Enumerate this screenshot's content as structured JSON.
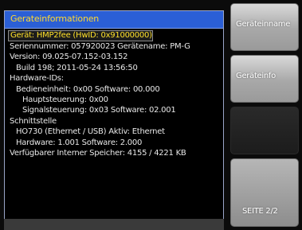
{
  "panel": {
    "title": "Gerateinformationen",
    "lines": [
      {
        "text": "Gerät: HMP2fee (HwID: 0x91000000)",
        "style": "hl"
      },
      {
        "text": "Seriennummer: 057920023 Gerätename: PM-G",
        "style": ""
      },
      {
        "text": "Version: 09.025-07.152-03.152",
        "style": ""
      },
      {
        "text": "Build 198; 2011-05-24 13:56:50",
        "style": "ind1"
      },
      {
        "text": "Hardware-IDs:",
        "style": ""
      },
      {
        "text": "Bedieneinheit: 0x00   Software: 00.000",
        "style": "ind1"
      },
      {
        "text": "Hauptsteuerung: 0x00",
        "style": "ind2"
      },
      {
        "text": "Signalsteuerung: 0x03   Software: 02.001",
        "style": "ind2"
      },
      {
        "text": "Schnittstelle",
        "style": ""
      },
      {
        "text": "HO730 (Ethernet / USB) Aktiv: Ethernet",
        "style": "ind1"
      },
      {
        "text": "Hardware: 1.001 Software: 2.000",
        "style": "ind1"
      },
      {
        "text": "Verfügbarer Interner Speicher: 4155 / 4221 KB",
        "style": ""
      }
    ]
  },
  "side_buttons": {
    "btn1": "Geräteinname",
    "btn2": "Geräteinfo",
    "btn3": "",
    "btn4": "SEITE 2/2"
  }
}
